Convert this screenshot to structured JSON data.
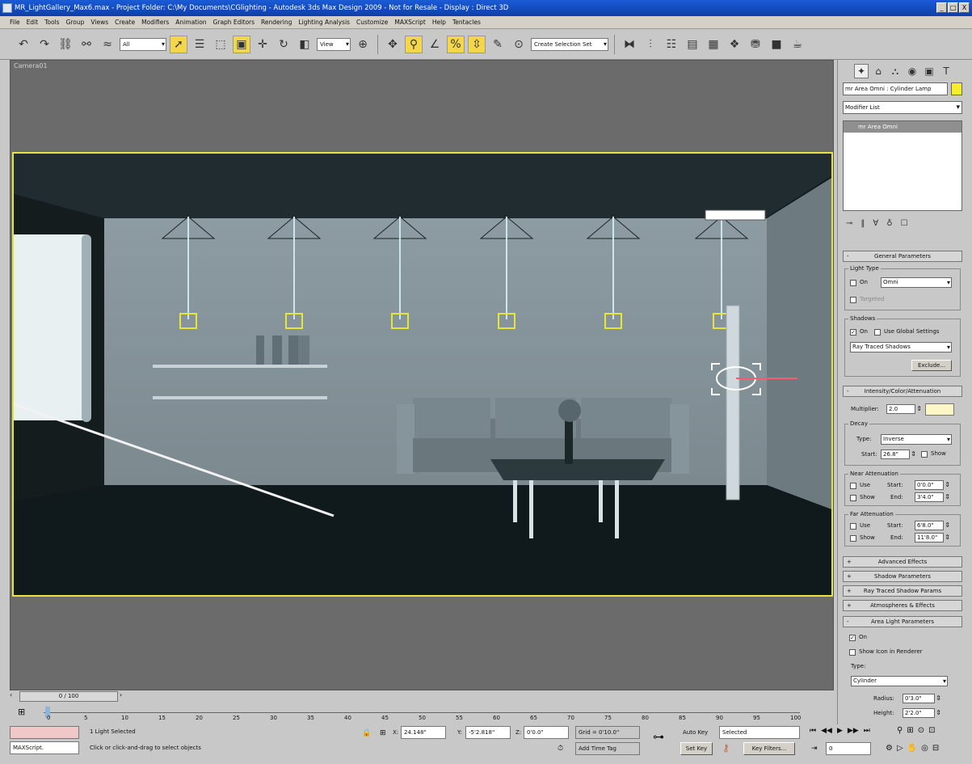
{
  "titlebar": {
    "text": "MR_LightGallery_Max6.max   - Project Folder: C:\\My Documents\\CGlighting   - Autodesk 3ds Max Design 2009  - Not for Resale   - Display : Direct 3D",
    "min": "_",
    "max": "□",
    "close": "X"
  },
  "menu": [
    "File",
    "Edit",
    "Tools",
    "Group",
    "Views",
    "Create",
    "Modifiers",
    "Animation",
    "Graph Editors",
    "Rendering",
    "Lighting Analysis",
    "Customize",
    "MAXScript",
    "Help",
    "Tentacles"
  ],
  "toolbar": {
    "filter": "All",
    "refcoord": "View",
    "selset": "Create Selection Set"
  },
  "viewport": {
    "label": "Camera01"
  },
  "panel": {
    "object_name": "mr Area Omni : Cylinder Lamp",
    "object_color": "#f4ef2a",
    "modifier_list": "Modifier List",
    "stack_item": "mr Area Omni",
    "general": {
      "title": "General Parameters",
      "light_type": "Light Type",
      "on": "On",
      "type_value": "Omni",
      "targeted": "Targeted",
      "shadows": "Shadows",
      "shadows_on": "On",
      "use_global": "Use Global Settings",
      "shadow_type": "Ray Traced Shadows",
      "exclude": "Exclude..."
    },
    "intensity": {
      "title": "Intensity/Color/Attenuation",
      "multiplier_label": "Multiplier:",
      "multiplier": "2.0",
      "color": "#fdf6c6",
      "decay": "Decay",
      "type_label": "Type:",
      "type": "Inverse",
      "start_label": "Start:",
      "start": "26.8\"",
      "show": "Show"
    },
    "near": {
      "title": "Near Attenuation",
      "use": "Use",
      "show": "Show",
      "start_label": "Start:",
      "start": "0'0.0\"",
      "end_label": "End:",
      "end": "3'4.0\""
    },
    "far": {
      "title": "Far Attenuation",
      "use": "Use",
      "show": "Show",
      "start_label": "Start:",
      "start": "6'8.0\"",
      "end_label": "End:",
      "end": "11'8.0\""
    },
    "rollouts": [
      "Advanced Effects",
      "Shadow Parameters",
      "Ray Traced Shadow Params",
      "Atmospheres & Effects"
    ],
    "area": {
      "title": "Area Light Parameters",
      "on": "On",
      "show_icon": "Show Icon in Renderer",
      "type_label": "Type:",
      "type": "Cylinder",
      "radius_label": "Radius:",
      "radius": "0'3.0\"",
      "height_label": "Height:",
      "height": "2'2.0\""
    }
  },
  "timeline": {
    "frame": "0 / 100",
    "ticks": [
      "0",
      "5",
      "10",
      "15",
      "20",
      "25",
      "30",
      "35",
      "40",
      "45",
      "50",
      "55",
      "60",
      "65",
      "70",
      "75",
      "80",
      "85",
      "90",
      "95",
      "100"
    ]
  },
  "status": {
    "script": "MAXScript.",
    "selected": "1 Light Selected",
    "prompt": "Click or click-and-drag to select objects",
    "x_label": "X:",
    "x": "24.148\"",
    "y_label": "Y:",
    "y": "-5'2.818\"",
    "z_label": "Z:",
    "z": "0'0.0\"",
    "grid": "Grid = 0'10.0\"",
    "add_time_tag": "Add Time Tag",
    "autokey": "Auto Key",
    "autokey_sel": "Selected",
    "setkey": "Set Key",
    "keyfilters": "Key Filters...",
    "frame": "0"
  }
}
